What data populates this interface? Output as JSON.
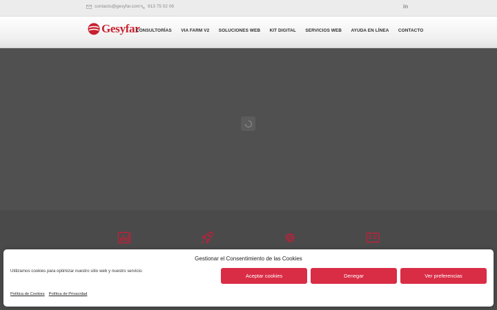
{
  "topbar": {
    "email": "contacto@gesyfar.com",
    "phone": "913 75 02 06",
    "linkedin_label": "in"
  },
  "brand": {
    "name": "Gesyfar",
    "color": "#c8202f"
  },
  "nav": {
    "items": [
      {
        "label": "CONSULTORÍAS"
      },
      {
        "label": "VIA FARM V2"
      },
      {
        "label": "SOLUCIONES WEB"
      },
      {
        "label": "KIT DIGITAL"
      },
      {
        "label": "SERVICIOS WEB"
      },
      {
        "label": "AYUDA EN LÍNEA"
      },
      {
        "label": "CONTACTO"
      }
    ]
  },
  "services": {
    "icons": [
      "bar-chart-icon",
      "rocket-icon",
      "gear-icon",
      "id-card-icon"
    ],
    "icon_color": "#c0203a"
  },
  "cookie": {
    "title": "Gestionar el Consentimiento de las Cookies",
    "message": "Utilizamos cookies para optimizar nuestro sitio web y nuestro servicio.",
    "accept_label": "Aceptar cookies",
    "deny_label": "Denegar",
    "prefs_label": "Ver preferencias",
    "cookie_policy_label": "Política de Cookies",
    "privacy_policy_label": "Política de Privacidad",
    "button_color": "#d92c45"
  }
}
